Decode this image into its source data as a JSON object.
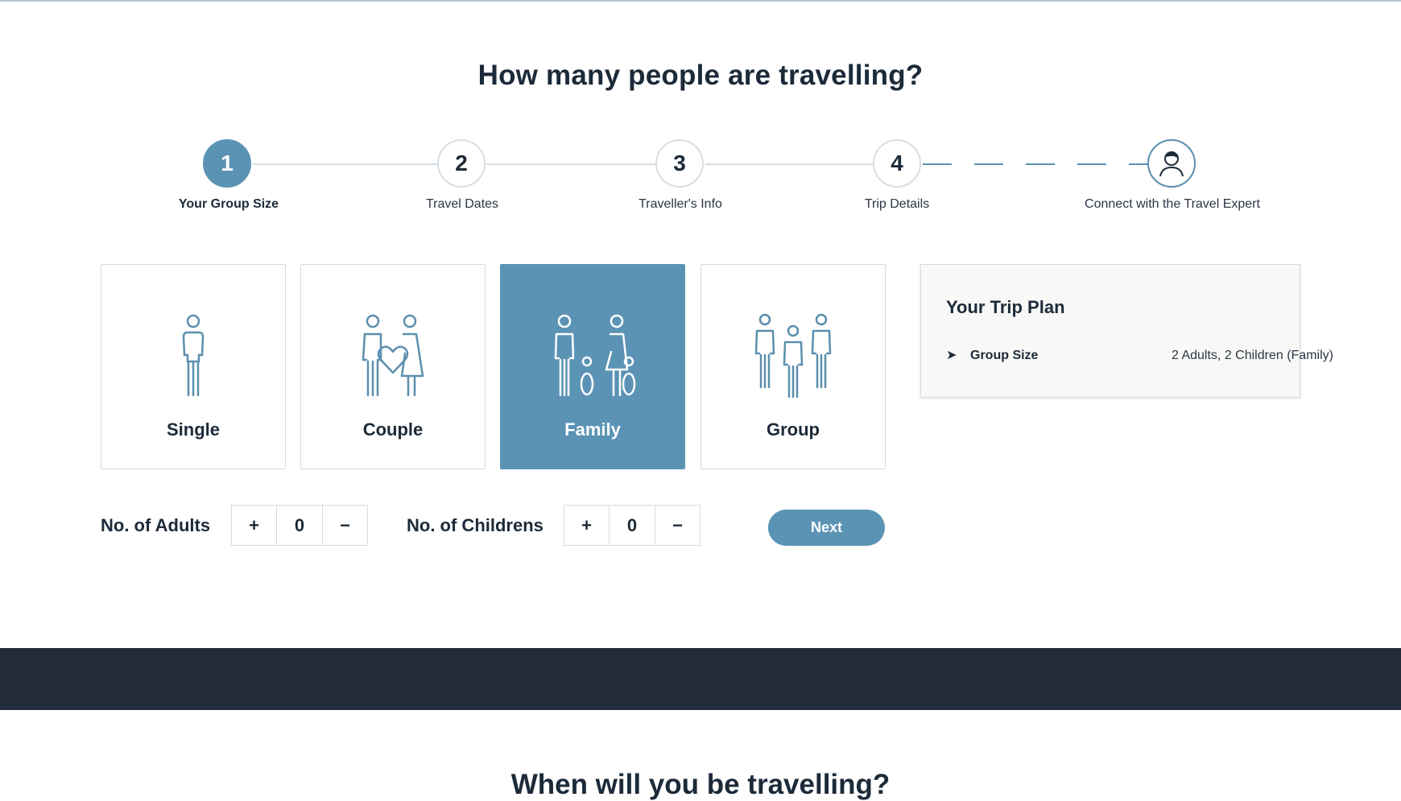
{
  "page": {
    "title": "How many people are travelling?",
    "next_section_title": "When will you be travelling?"
  },
  "stepper": {
    "steps": [
      {
        "number": "1",
        "label": "Your Group Size",
        "active": true
      },
      {
        "number": "2",
        "label": "Travel Dates",
        "active": false
      },
      {
        "number": "3",
        "label": "Traveller's Info",
        "active": false
      },
      {
        "number": "4",
        "label": "Trip Details",
        "active": false
      },
      {
        "number": "",
        "label": "Connect with the Travel Expert",
        "icon": "travel-expert-avatar-icon",
        "active": false
      }
    ]
  },
  "group_options": [
    {
      "label": "Single",
      "icon": "single-person-icon",
      "selected": false
    },
    {
      "label": "Couple",
      "icon": "couple-heart-icon",
      "selected": false
    },
    {
      "label": "Family",
      "icon": "family-icon",
      "selected": true
    },
    {
      "label": "Group",
      "icon": "group-icon",
      "selected": false
    }
  ],
  "trip_plan": {
    "title": "Your Trip Plan",
    "rows": [
      {
        "key": "Group Size",
        "value": "2 Adults, 2 Children (Family)",
        "icon": "arrow-right-icon"
      }
    ]
  },
  "counters": {
    "adults": {
      "label": "No. of Adults",
      "value": "0",
      "plus": "+",
      "minus": "−"
    },
    "children": {
      "label": "No. of Childrens",
      "value": "0",
      "plus": "+",
      "minus": "−"
    }
  },
  "actions": {
    "next_label": "Next"
  },
  "colors": {
    "accent": "#5b93b5",
    "dark_band": "#222c3a",
    "text": "#1c2a39"
  }
}
